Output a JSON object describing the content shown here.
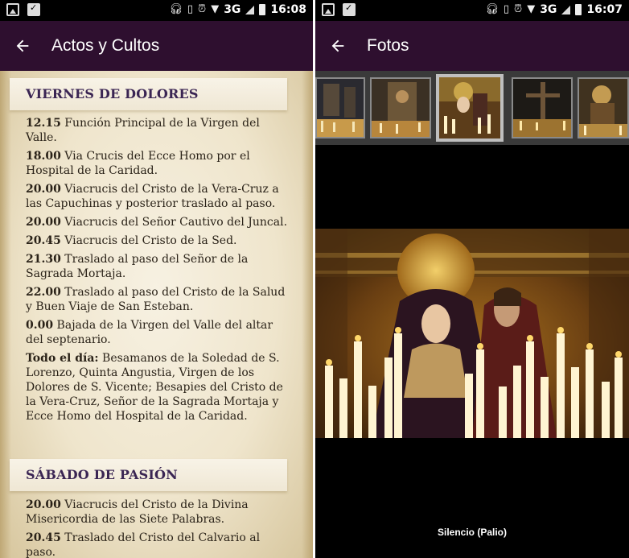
{
  "left_screen": {
    "status_bar": {
      "time": "16:08",
      "network": "3G"
    },
    "app_bar": {
      "title": "Actos y Cultos"
    },
    "sections": [
      {
        "title": "VIERNES DE DOLORES",
        "entries": [
          {
            "time": "12.15",
            "text": " Función Principal de la Virgen del Valle."
          },
          {
            "time": "18.00",
            "text": " Via Crucis del Ecce Homo por el Hospital de la Caridad."
          },
          {
            "time": "20.00",
            "text": " Viacrucis del Cristo de la Vera-Cruz a las Capuchinas y posterior traslado al paso."
          },
          {
            "time": "20.00",
            "text": " Viacrucis del Señor Cautivo del Juncal."
          },
          {
            "time": "20.45",
            "text": " Viacrucis del Cristo de la Sed."
          },
          {
            "time": "21.30",
            "text": " Traslado al paso del Señor de la Sagrada Mortaja."
          },
          {
            "time": "22.00",
            "text": " Traslado al paso del Cristo de la Salud y Buen Viaje de San Esteban."
          },
          {
            "time": "0.00",
            "text": " Bajada de la Virgen del Valle del altar del septenario."
          },
          {
            "time": "Todo el día:",
            "text": " Besamanos de la Soledad de S. Lorenzo, Quinta Angustia, Virgen de los Dolores de S. Vicente; Besapies del Cristo de la Vera-Cruz, Señor de la Sagrada Mortaja y Ecce Homo del Hospital de la Caridad."
          }
        ]
      },
      {
        "title": "SÁBADO DE PASIÓN",
        "entries": [
          {
            "time": "20.00",
            "text": " Viacrucis del Cristo de la Divina Misericordia de las Siete Palabras."
          },
          {
            "time": "20.45",
            "text": " Traslado del Cristo del Calvario al paso."
          }
        ]
      }
    ]
  },
  "right_screen": {
    "status_bar": {
      "time": "16:07",
      "network": "3G"
    },
    "app_bar": {
      "title": "Fotos"
    },
    "thumbnails": [
      {
        "selected": false
      },
      {
        "selected": false
      },
      {
        "selected": true
      },
      {
        "selected": false
      },
      {
        "selected": false
      }
    ],
    "photo_caption": "Silencio (Palio)"
  },
  "colors": {
    "app_bar": "#2e0f2f",
    "section_title": "#3a2553",
    "parchment": "#efe5cc"
  },
  "icons": [
    "image-icon",
    "bag-check-icon",
    "headphones-icon",
    "vibrate-icon",
    "alarm-icon",
    "wifi-icon",
    "signal-icon",
    "battery-icon",
    "back-arrow-icon"
  ]
}
